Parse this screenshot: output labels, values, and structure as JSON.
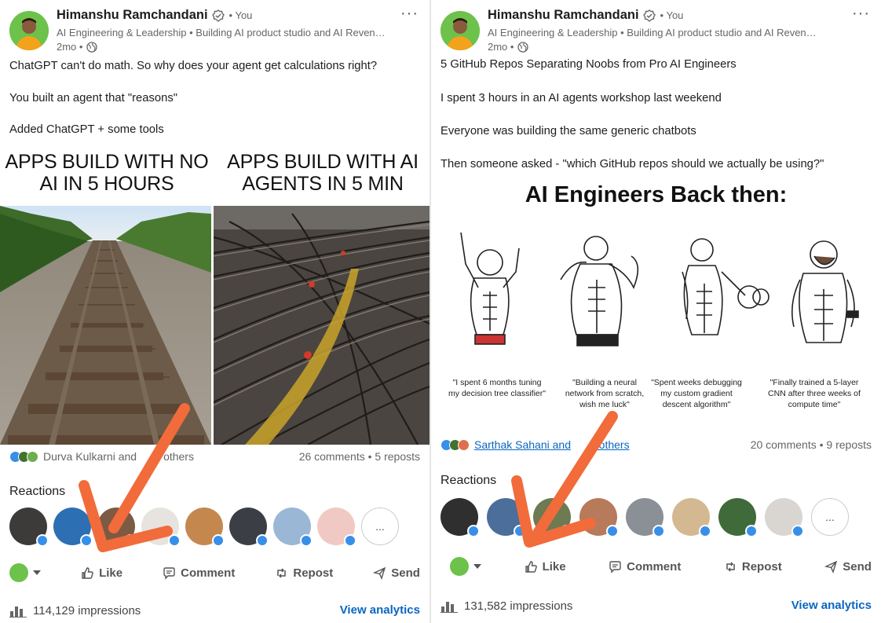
{
  "left_post": {
    "author": "Himanshu Ramchandani",
    "you_label": "• You",
    "headline": "AI Engineering & Leadership • Building AI product studio and AI Revenue...",
    "time": "2mo •",
    "text_lines": [
      "ChatGPT can't do math. So why does your agent get calculations right?",
      "You built an agent that \"reasons\"",
      "Added ChatGPT + some tools"
    ],
    "meme": {
      "left_caption": "APPS BUILD WITH NO AI IN 5 HOURS",
      "right_caption": "APPS BUILD WITH AI AGENTS IN 5 MIN"
    },
    "reactors_text": "Durva Kulkarni and",
    "reactors_text_tail": "others",
    "stats": "26 comments • 5 reposts",
    "reactions_title": "Reactions",
    "reactor_count": 8,
    "more_label": "...",
    "actions": {
      "like": "Like",
      "comment": "Comment",
      "repost": "Repost",
      "send": "Send"
    },
    "impressions": "114,129 impressions",
    "analytics": "View analytics"
  },
  "right_post": {
    "author": "Himanshu Ramchandani",
    "you_label": "• You",
    "headline": "AI Engineering & Leadership • Building AI product studio and AI Revenue...",
    "time": "2mo •",
    "text_lines": [
      "5 GitHub Repos Separating Noobs from Pro AI Engineers",
      "I spent 3 hours in an AI agents workshop last weekend",
      "Everyone was building the same generic chatbots",
      "Then someone asked - \"which GitHub repos should we actually be using?\""
    ],
    "meme": {
      "title": "AI Engineers Back then:",
      "quotes": [
        "\"I spent 6 months tuning my decision tree classifier\"",
        "\"Building a neural network from scratch, wish me luck\"",
        "\"Spent weeks debugging my custom gradient descent algorithm\"",
        "\"Finally trained a 5-layer CNN after three weeks of compute time\""
      ]
    },
    "reactors_text": "Sarthak Sahani and",
    "reactors_text_tail": "1 others",
    "stats": "20 comments • 9 reposts",
    "reactions_title": "Reactions",
    "reactor_count": 8,
    "more_label": "...",
    "actions": {
      "like": "Like",
      "comment": "Comment",
      "repost": "Repost",
      "send": "Send"
    },
    "impressions": "131,582 impressions",
    "analytics": "View analytics"
  },
  "colors": {
    "link_blue": "#0a66c2",
    "annotation_arrow": "#f26b3a",
    "avatar_green": "#6cc24a"
  }
}
